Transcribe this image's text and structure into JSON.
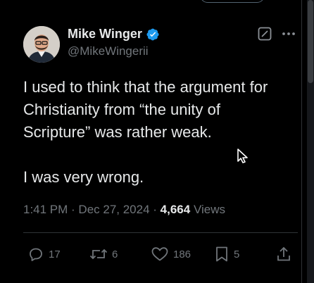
{
  "author": {
    "name": "Mike Winger",
    "handle": "@MikeWingerii",
    "verified": true
  },
  "tweet": {
    "paragraph1": "I used to think that the argument for Christianity from “the unity of Scripture” was rather weak.",
    "paragraph2": "I was very wrong."
  },
  "meta": {
    "time": "1:41 PM",
    "separator1": " · ",
    "date": "Dec 27, 2024",
    "separator2": " · ",
    "views_count": "4,664",
    "views_label": " Views"
  },
  "actions": {
    "replies": "17",
    "reposts": "6",
    "likes": "186",
    "bookmarks": "5"
  },
  "colors": {
    "background": "#000000",
    "text": "#e7e9ea",
    "secondary": "#71767b",
    "verified": "#1d9bf0",
    "divider": "#2f3336"
  },
  "icons": [
    "verified-badge-icon",
    "grok-icon",
    "more-icon",
    "reply-icon",
    "repost-icon",
    "like-icon",
    "bookmark-icon",
    "share-icon",
    "mouse-cursor-icon"
  ]
}
